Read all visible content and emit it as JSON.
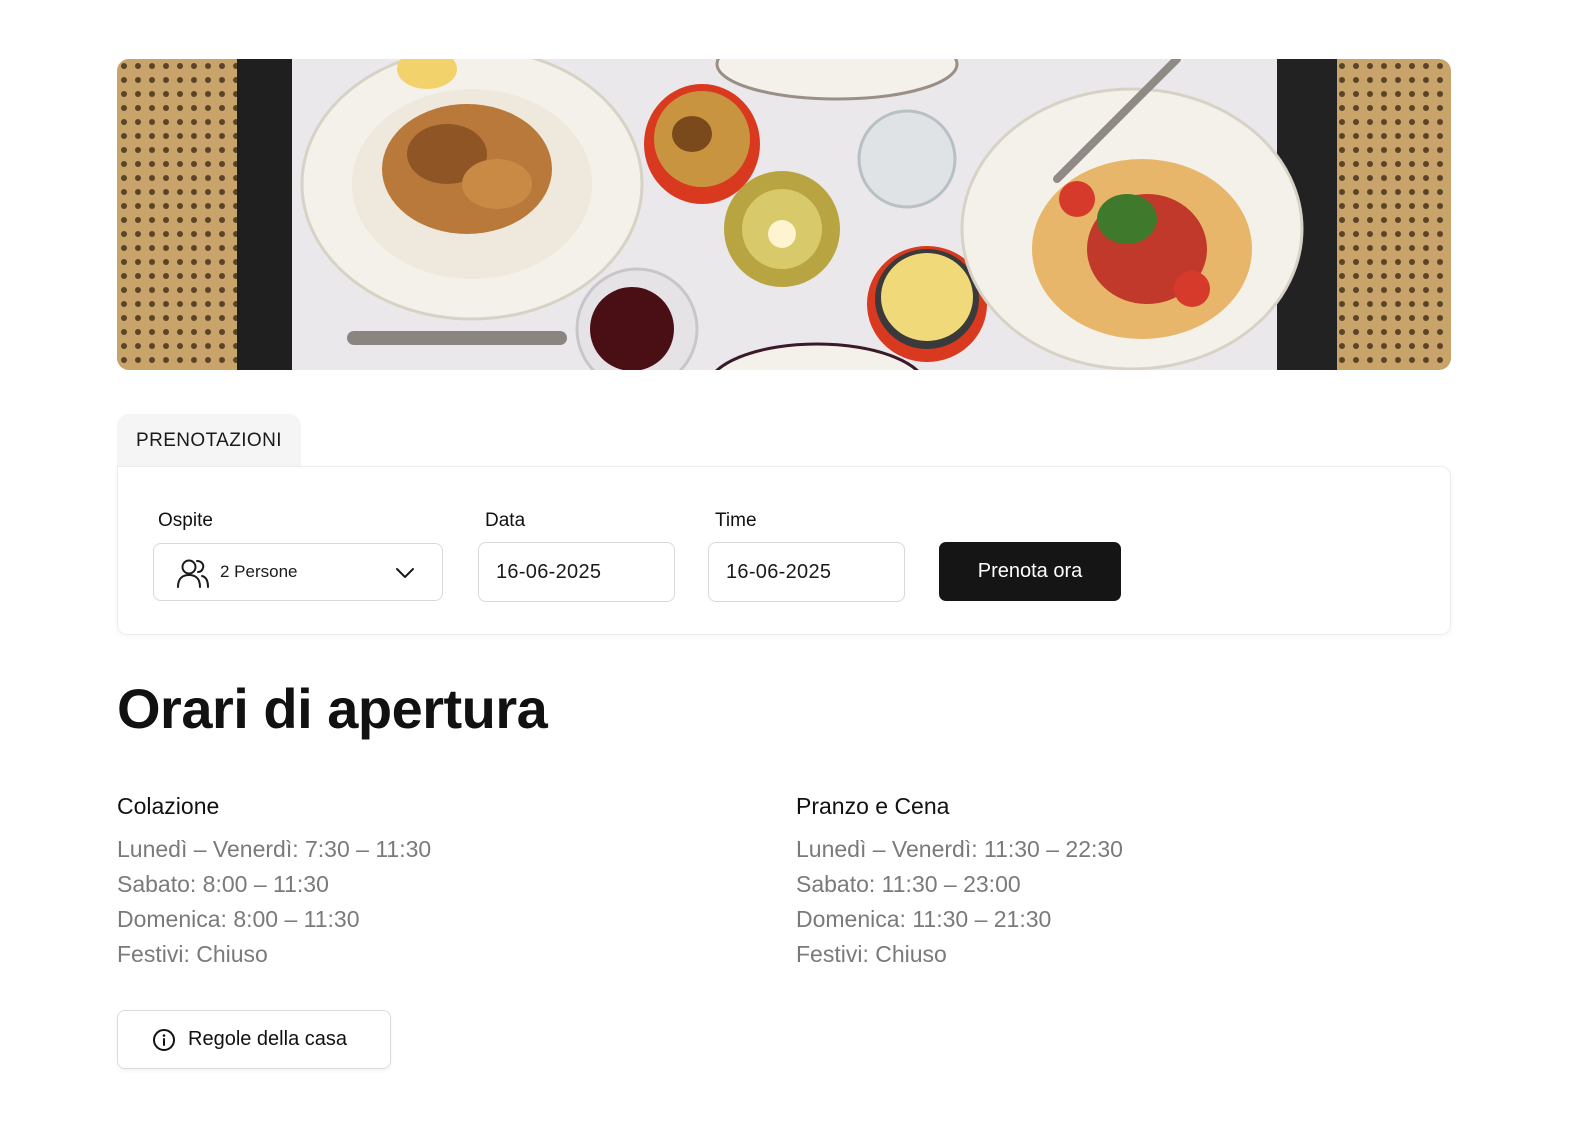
{
  "hero": {
    "image": "food-table-photo"
  },
  "booking": {
    "tab_label": "PRENOTAZIONI",
    "guests": {
      "label": "Ospite",
      "value": "2 Persone",
      "icon": "people-icon"
    },
    "date": {
      "label": "Data",
      "value": "16-06-2025"
    },
    "time": {
      "label": "Time",
      "value": "16-06-2025"
    },
    "submit_label": "Prenota ora"
  },
  "hours": {
    "title": "Orari di apertura",
    "breakfast": {
      "title": "Colazione",
      "lines": [
        "Lunedì – Venerdì: 7:30 – 11:30",
        "Sabato: 8:00 – 11:30",
        "Domenica: 8:00 – 11:30",
        "Festivi: Chiuso"
      ]
    },
    "lunch_dinner": {
      "title": "Pranzo e Cena",
      "lines": [
        "Lunedì – Venerdì: 11:30 – 22:30",
        "Sabato: 11:30 – 23:00",
        "Domenica: 11:30 – 21:30",
        "Festivi: Chiuso"
      ]
    }
  },
  "rules": {
    "label": "Regole della casa",
    "icon": "info-icon"
  },
  "colors": {
    "accent": "#151515",
    "muted_text": "#7a7a7a",
    "border": "#d9d9d9",
    "tab_bg": "#f5f5f5"
  }
}
